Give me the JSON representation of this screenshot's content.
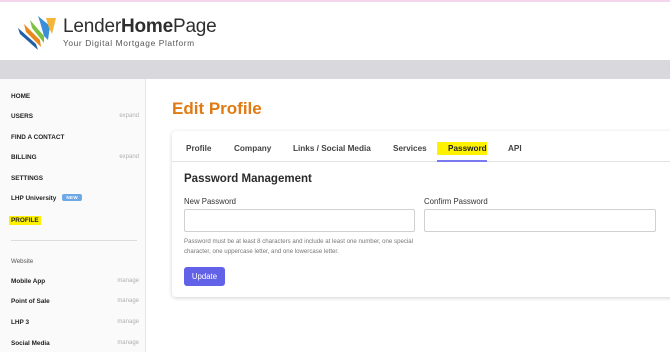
{
  "brand": {
    "name_part1": "Lender",
    "name_part2": "Home",
    "name_part3": "Page",
    "tagline": "Your Digital Mortgage Platform"
  },
  "sidebar": {
    "items": [
      {
        "label": "HOME",
        "aux": ""
      },
      {
        "label": "USERS",
        "aux": "expand"
      },
      {
        "label": "FIND A CONTACT",
        "aux": ""
      },
      {
        "label": "BILLING",
        "aux": "expand"
      },
      {
        "label": "SETTINGS",
        "aux": ""
      },
      {
        "label": "LHP University",
        "aux": "",
        "badge": "NEW"
      },
      {
        "label": "PROFILE",
        "aux": "",
        "highlighted": true
      }
    ],
    "section_title": "Website",
    "website_items": [
      {
        "label": "Mobile App",
        "aux": "manage"
      },
      {
        "label": "Point of Sale",
        "aux": "manage"
      },
      {
        "label": "LHP 3",
        "aux": "manage"
      },
      {
        "label": "Social Media",
        "aux": "manage"
      }
    ]
  },
  "main": {
    "title": "Edit Profile",
    "tabs": [
      {
        "label": "Profile"
      },
      {
        "label": "Company"
      },
      {
        "label": "Links / Social Media"
      },
      {
        "label": "Services"
      },
      {
        "label": "Password",
        "active": true
      },
      {
        "label": "API"
      }
    ],
    "section_heading": "Password Management",
    "new_password": {
      "label": "New Password",
      "value": "",
      "placeholder": ""
    },
    "confirm_password": {
      "label": "Confirm Password",
      "value": "",
      "placeholder": ""
    },
    "help_text": "Password must be at least 8 characters and include at least one number, one special character, one uppercase letter, and one lowercase letter.",
    "update_label": "Update"
  },
  "colors": {
    "accent": "#e07a12",
    "button": "#6262e8",
    "highlight": "#fff200",
    "badge": "#6fa8e6"
  }
}
